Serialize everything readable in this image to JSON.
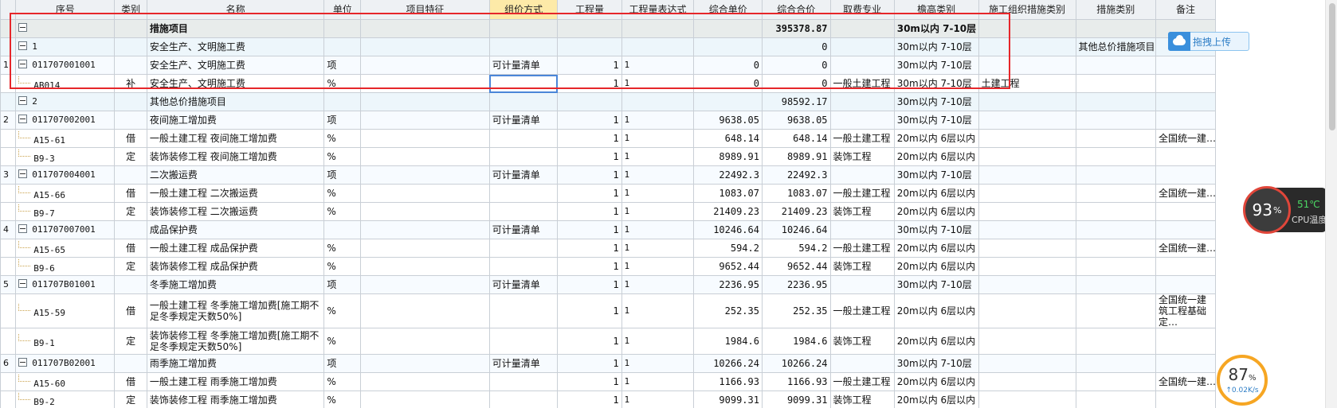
{
  "header": {
    "columns": [
      "序号",
      "类别",
      "名称",
      "单位",
      "项目特征",
      "组价方式",
      "工程量",
      "工程量表达式",
      "综合单价",
      "综合合价",
      "取费专业",
      "檐高类别",
      "施工组织措施类别",
      "措施类别",
      "备注"
    ],
    "highlight_column": "组价方式"
  },
  "rows": [
    {
      "type": "root",
      "seq": "",
      "code": "",
      "cat": "",
      "name": "措施项目",
      "unit": "",
      "feature": "",
      "method": "",
      "qty": "",
      "expr": "",
      "price": "",
      "total": "395378.87",
      "fee": "",
      "eave": "30m以内 7-10层",
      "org": "",
      "mcat": "",
      "note": ""
    },
    {
      "type": "group",
      "seq": "",
      "code": "1",
      "cat": "",
      "name": "安全生产、文明施工费",
      "unit": "",
      "feature": "",
      "method": "",
      "qty": "",
      "expr": "",
      "price": "",
      "total": "0",
      "fee": "",
      "eave": "30m以内 7-10层",
      "org": "",
      "mcat": "其他总价措施项目",
      "note": ""
    },
    {
      "type": "item",
      "seq": "1",
      "code": "011707001001",
      "cat": "",
      "name": "安全生产、文明施工费",
      "unit": "项",
      "feature": "",
      "method": "可计量清单",
      "qty": "1",
      "expr": "1",
      "price": "0",
      "total": "0",
      "fee": "",
      "eave": "30m以内 7-10层",
      "org": "",
      "mcat": "",
      "note": ""
    },
    {
      "type": "sub",
      "seq": "",
      "code": "AB014",
      "cat": "补",
      "name": "安全生产、文明施工费",
      "unit": "%",
      "feature": "",
      "method": "",
      "qty": "1",
      "expr": "1",
      "price": "0",
      "total": "0",
      "fee": "一般土建工程",
      "eave": "30m以内 7-10层",
      "org": "土建工程",
      "mcat": "",
      "note": "",
      "editing": true
    },
    {
      "type": "group",
      "seq": "",
      "code": "2",
      "cat": "",
      "name": "其他总价措施项目",
      "unit": "",
      "feature": "",
      "method": "",
      "qty": "",
      "expr": "",
      "price": "",
      "total": "98592.17",
      "fee": "",
      "eave": "30m以内 7-10层",
      "org": "",
      "mcat": "",
      "note": ""
    },
    {
      "type": "item",
      "seq": "2",
      "code": "011707002001",
      "cat": "",
      "name": "夜间施工增加费",
      "unit": "项",
      "feature": "",
      "method": "可计量清单",
      "qty": "1",
      "expr": "1",
      "price": "9638.05",
      "total": "9638.05",
      "fee": "",
      "eave": "30m以内 7-10层",
      "org": "",
      "mcat": "",
      "note": ""
    },
    {
      "type": "sub",
      "seq": "",
      "code": "A15-61",
      "cat": "借",
      "name": "一般土建工程 夜间施工增加费",
      "unit": "%",
      "feature": "",
      "method": "",
      "qty": "1",
      "expr": "1",
      "price": "648.14",
      "total": "648.14",
      "fee": "一般土建工程",
      "eave": "20m以内 6层以内",
      "org": "",
      "mcat": "",
      "note": "全国统一建…"
    },
    {
      "type": "sub",
      "seq": "",
      "code": "B9-3",
      "cat": "定",
      "name": "装饰装修工程 夜间施工增加费",
      "unit": "%",
      "feature": "",
      "method": "",
      "qty": "1",
      "expr": "1",
      "price": "8989.91",
      "total": "8989.91",
      "fee": "装饰工程",
      "eave": "20m以内 6层以内",
      "org": "",
      "mcat": "",
      "note": ""
    },
    {
      "type": "item",
      "seq": "3",
      "code": "011707004001",
      "cat": "",
      "name": "二次搬运费",
      "unit": "项",
      "feature": "",
      "method": "可计量清单",
      "qty": "1",
      "expr": "1",
      "price": "22492.3",
      "total": "22492.3",
      "fee": "",
      "eave": "30m以内 7-10层",
      "org": "",
      "mcat": "",
      "note": ""
    },
    {
      "type": "sub",
      "seq": "",
      "code": "A15-66",
      "cat": "借",
      "name": "一般土建工程 二次搬运费",
      "unit": "%",
      "feature": "",
      "method": "",
      "qty": "1",
      "expr": "1",
      "price": "1083.07",
      "total": "1083.07",
      "fee": "一般土建工程",
      "eave": "20m以内 6层以内",
      "org": "",
      "mcat": "",
      "note": "全国统一建…"
    },
    {
      "type": "sub",
      "seq": "",
      "code": "B9-7",
      "cat": "定",
      "name": "装饰装修工程 二次搬运费",
      "unit": "%",
      "feature": "",
      "method": "",
      "qty": "1",
      "expr": "1",
      "price": "21409.23",
      "total": "21409.23",
      "fee": "装饰工程",
      "eave": "20m以内 6层以内",
      "org": "",
      "mcat": "",
      "note": ""
    },
    {
      "type": "item",
      "seq": "4",
      "code": "011707007001",
      "cat": "",
      "name": "成品保护费",
      "unit": "",
      "feature": "",
      "method": "可计量清单",
      "qty": "1",
      "expr": "1",
      "price": "10246.64",
      "total": "10246.64",
      "fee": "",
      "eave": "30m以内 7-10层",
      "org": "",
      "mcat": "",
      "note": ""
    },
    {
      "type": "sub",
      "seq": "",
      "code": "A15-65",
      "cat": "借",
      "name": "一般土建工程 成品保护费",
      "unit": "%",
      "feature": "",
      "method": "",
      "qty": "1",
      "expr": "1",
      "price": "594.2",
      "total": "594.2",
      "fee": "一般土建工程",
      "eave": "20m以内 6层以内",
      "org": "",
      "mcat": "",
      "note": "全国统一建…"
    },
    {
      "type": "sub",
      "seq": "",
      "code": "B9-6",
      "cat": "定",
      "name": "装饰装修工程 成品保护费",
      "unit": "%",
      "feature": "",
      "method": "",
      "qty": "1",
      "expr": "1",
      "price": "9652.44",
      "total": "9652.44",
      "fee": "装饰工程",
      "eave": "20m以内 6层以内",
      "org": "",
      "mcat": "",
      "note": ""
    },
    {
      "type": "item",
      "seq": "5",
      "code": "011707B01001",
      "cat": "",
      "name": "冬季施工增加费",
      "unit": "项",
      "feature": "",
      "method": "可计量清单",
      "qty": "1",
      "expr": "1",
      "price": "2236.95",
      "total": "2236.95",
      "fee": "",
      "eave": "30m以内 7-10层",
      "org": "",
      "mcat": "",
      "note": ""
    },
    {
      "type": "sub",
      "tall": true,
      "seq": "",
      "code": "A15-59",
      "cat": "借",
      "name": "一般土建工程 冬季施工增加费[施工期不足冬季规定天数50%]",
      "unit": "%",
      "feature": "",
      "method": "",
      "qty": "1",
      "expr": "1",
      "price": "252.35",
      "total": "252.35",
      "fee": "一般土建工程",
      "eave": "20m以内 6层以内",
      "org": "",
      "mcat": "",
      "note": "全国统一建筑工程基础定…"
    },
    {
      "type": "sub",
      "tall": true,
      "seq": "",
      "code": "B9-1",
      "cat": "定",
      "name": "装饰装修工程 冬季施工增加费[施工期不足冬季规定天数50%]",
      "unit": "%",
      "feature": "",
      "method": "",
      "qty": "1",
      "expr": "1",
      "price": "1984.6",
      "total": "1984.6",
      "fee": "装饰工程",
      "eave": "20m以内 6层以内",
      "org": "",
      "mcat": "",
      "note": ""
    },
    {
      "type": "item",
      "seq": "6",
      "code": "011707B02001",
      "cat": "",
      "name": "雨季施工增加费",
      "unit": "项",
      "feature": "",
      "method": "可计量清单",
      "qty": "1",
      "expr": "1",
      "price": "10266.24",
      "total": "10266.24",
      "fee": "",
      "eave": "30m以内 7-10层",
      "org": "",
      "mcat": "",
      "note": ""
    },
    {
      "type": "sub",
      "seq": "",
      "code": "A15-60",
      "cat": "借",
      "name": "一般土建工程 雨季施工增加费",
      "unit": "%",
      "feature": "",
      "method": "",
      "qty": "1",
      "expr": "1",
      "price": "1166.93",
      "total": "1166.93",
      "fee": "一般土建工程",
      "eave": "20m以内 6层以内",
      "org": "",
      "mcat": "",
      "note": "全国统一建…"
    },
    {
      "type": "sub",
      "seq": "",
      "code": "B9-2",
      "cat": "定",
      "name": "装饰装修工程 雨季施工增加费",
      "unit": "%",
      "feature": "",
      "method": "",
      "qty": "1",
      "expr": "1",
      "price": "9099.31",
      "total": "9099.31",
      "fee": "装饰工程",
      "eave": "20m以内 6层以内",
      "org": "",
      "mcat": "",
      "note": ""
    }
  ],
  "upload_button": {
    "label": "拖拽上传"
  },
  "cpu_monitor": {
    "percent": "93",
    "percent_unit": "%",
    "temperature": "51℃",
    "label": "CPU温度"
  },
  "net_monitor": {
    "percent": "87",
    "percent_unit": "%",
    "speed": "↑0.02K/s"
  },
  "colors": {
    "highlight_box": "#e6262a",
    "header_active": "#fdeaa8",
    "accent": "#3a8fdc"
  }
}
